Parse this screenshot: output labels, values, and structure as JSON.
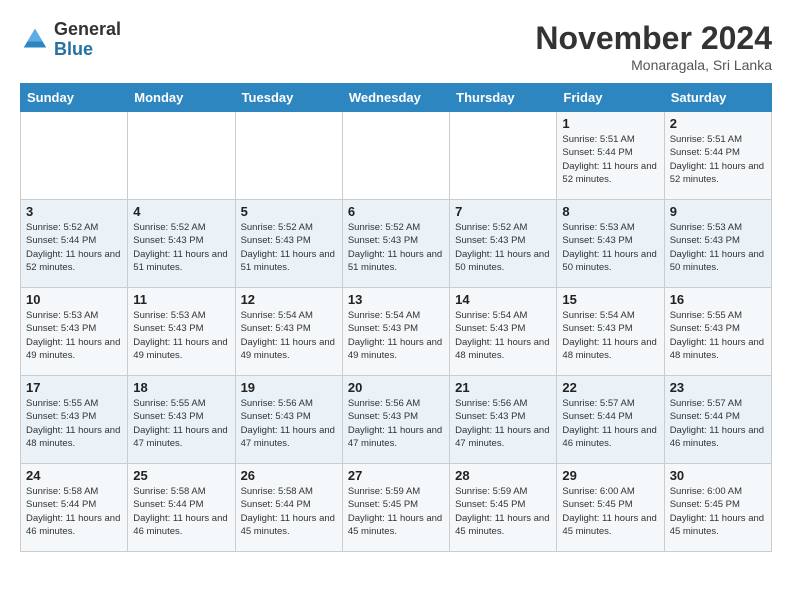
{
  "logo": {
    "general": "General",
    "blue": "Blue"
  },
  "header": {
    "title": "November 2024",
    "location": "Monaragala, Sri Lanka"
  },
  "weekdays": [
    "Sunday",
    "Monday",
    "Tuesday",
    "Wednesday",
    "Thursday",
    "Friday",
    "Saturday"
  ],
  "weeks": [
    [
      {
        "day": "",
        "info": ""
      },
      {
        "day": "",
        "info": ""
      },
      {
        "day": "",
        "info": ""
      },
      {
        "day": "",
        "info": ""
      },
      {
        "day": "",
        "info": ""
      },
      {
        "day": "1",
        "info": "Sunrise: 5:51 AM\nSunset: 5:44 PM\nDaylight: 11 hours and 52 minutes."
      },
      {
        "day": "2",
        "info": "Sunrise: 5:51 AM\nSunset: 5:44 PM\nDaylight: 11 hours and 52 minutes."
      }
    ],
    [
      {
        "day": "3",
        "info": "Sunrise: 5:52 AM\nSunset: 5:44 PM\nDaylight: 11 hours and 52 minutes."
      },
      {
        "day": "4",
        "info": "Sunrise: 5:52 AM\nSunset: 5:43 PM\nDaylight: 11 hours and 51 minutes."
      },
      {
        "day": "5",
        "info": "Sunrise: 5:52 AM\nSunset: 5:43 PM\nDaylight: 11 hours and 51 minutes."
      },
      {
        "day": "6",
        "info": "Sunrise: 5:52 AM\nSunset: 5:43 PM\nDaylight: 11 hours and 51 minutes."
      },
      {
        "day": "7",
        "info": "Sunrise: 5:52 AM\nSunset: 5:43 PM\nDaylight: 11 hours and 50 minutes."
      },
      {
        "day": "8",
        "info": "Sunrise: 5:53 AM\nSunset: 5:43 PM\nDaylight: 11 hours and 50 minutes."
      },
      {
        "day": "9",
        "info": "Sunrise: 5:53 AM\nSunset: 5:43 PM\nDaylight: 11 hours and 50 minutes."
      }
    ],
    [
      {
        "day": "10",
        "info": "Sunrise: 5:53 AM\nSunset: 5:43 PM\nDaylight: 11 hours and 49 minutes."
      },
      {
        "day": "11",
        "info": "Sunrise: 5:53 AM\nSunset: 5:43 PM\nDaylight: 11 hours and 49 minutes."
      },
      {
        "day": "12",
        "info": "Sunrise: 5:54 AM\nSunset: 5:43 PM\nDaylight: 11 hours and 49 minutes."
      },
      {
        "day": "13",
        "info": "Sunrise: 5:54 AM\nSunset: 5:43 PM\nDaylight: 11 hours and 49 minutes."
      },
      {
        "day": "14",
        "info": "Sunrise: 5:54 AM\nSunset: 5:43 PM\nDaylight: 11 hours and 48 minutes."
      },
      {
        "day": "15",
        "info": "Sunrise: 5:54 AM\nSunset: 5:43 PM\nDaylight: 11 hours and 48 minutes."
      },
      {
        "day": "16",
        "info": "Sunrise: 5:55 AM\nSunset: 5:43 PM\nDaylight: 11 hours and 48 minutes."
      }
    ],
    [
      {
        "day": "17",
        "info": "Sunrise: 5:55 AM\nSunset: 5:43 PM\nDaylight: 11 hours and 48 minutes."
      },
      {
        "day": "18",
        "info": "Sunrise: 5:55 AM\nSunset: 5:43 PM\nDaylight: 11 hours and 47 minutes."
      },
      {
        "day": "19",
        "info": "Sunrise: 5:56 AM\nSunset: 5:43 PM\nDaylight: 11 hours and 47 minutes."
      },
      {
        "day": "20",
        "info": "Sunrise: 5:56 AM\nSunset: 5:43 PM\nDaylight: 11 hours and 47 minutes."
      },
      {
        "day": "21",
        "info": "Sunrise: 5:56 AM\nSunset: 5:43 PM\nDaylight: 11 hours and 47 minutes."
      },
      {
        "day": "22",
        "info": "Sunrise: 5:57 AM\nSunset: 5:44 PM\nDaylight: 11 hours and 46 minutes."
      },
      {
        "day": "23",
        "info": "Sunrise: 5:57 AM\nSunset: 5:44 PM\nDaylight: 11 hours and 46 minutes."
      }
    ],
    [
      {
        "day": "24",
        "info": "Sunrise: 5:58 AM\nSunset: 5:44 PM\nDaylight: 11 hours and 46 minutes."
      },
      {
        "day": "25",
        "info": "Sunrise: 5:58 AM\nSunset: 5:44 PM\nDaylight: 11 hours and 46 minutes."
      },
      {
        "day": "26",
        "info": "Sunrise: 5:58 AM\nSunset: 5:44 PM\nDaylight: 11 hours and 45 minutes."
      },
      {
        "day": "27",
        "info": "Sunrise: 5:59 AM\nSunset: 5:45 PM\nDaylight: 11 hours and 45 minutes."
      },
      {
        "day": "28",
        "info": "Sunrise: 5:59 AM\nSunset: 5:45 PM\nDaylight: 11 hours and 45 minutes."
      },
      {
        "day": "29",
        "info": "Sunrise: 6:00 AM\nSunset: 5:45 PM\nDaylight: 11 hours and 45 minutes."
      },
      {
        "day": "30",
        "info": "Sunrise: 6:00 AM\nSunset: 5:45 PM\nDaylight: 11 hours and 45 minutes."
      }
    ]
  ]
}
